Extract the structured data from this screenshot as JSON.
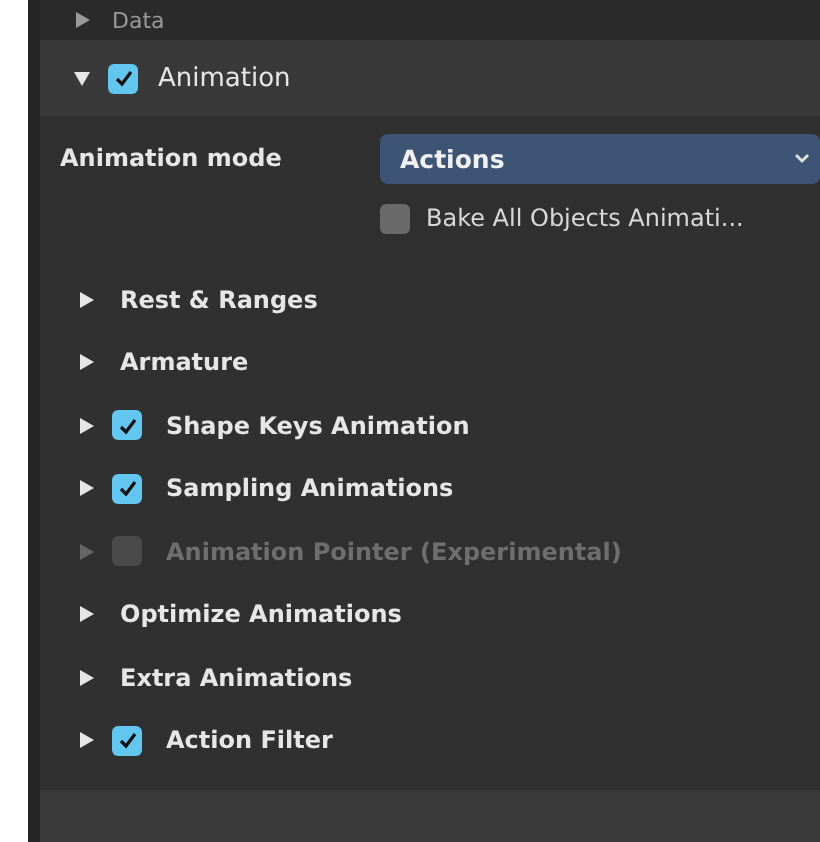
{
  "previous_panel": {
    "label": "Data",
    "expanded": false
  },
  "panel": {
    "label": "Animation",
    "expanded": true,
    "checked": true
  },
  "animation_mode": {
    "label": "Animation mode",
    "value": "Actions"
  },
  "bake_all": {
    "label": "Bake All Objects Animati...",
    "checked": false
  },
  "subpanels": [
    {
      "kind": "plain",
      "label": "Rest & Ranges",
      "expanded": false,
      "disabled": false
    },
    {
      "kind": "plain",
      "label": "Armature",
      "expanded": false,
      "disabled": false
    },
    {
      "kind": "checkbox",
      "label": "Shape Keys Animation",
      "expanded": false,
      "checked": true,
      "disabled": false
    },
    {
      "kind": "checkbox",
      "label": "Sampling Animations",
      "expanded": false,
      "checked": true,
      "disabled": false
    },
    {
      "kind": "checkbox",
      "label": "Animation Pointer (Experimental)",
      "expanded": false,
      "checked": false,
      "disabled": true
    },
    {
      "kind": "plain",
      "label": "Optimize Animations",
      "expanded": false,
      "disabled": false
    },
    {
      "kind": "plain",
      "label": "Extra Animations",
      "expanded": false,
      "disabled": false
    },
    {
      "kind": "checkbox",
      "label": "Action Filter",
      "expanded": false,
      "checked": true,
      "disabled": false
    }
  ]
}
